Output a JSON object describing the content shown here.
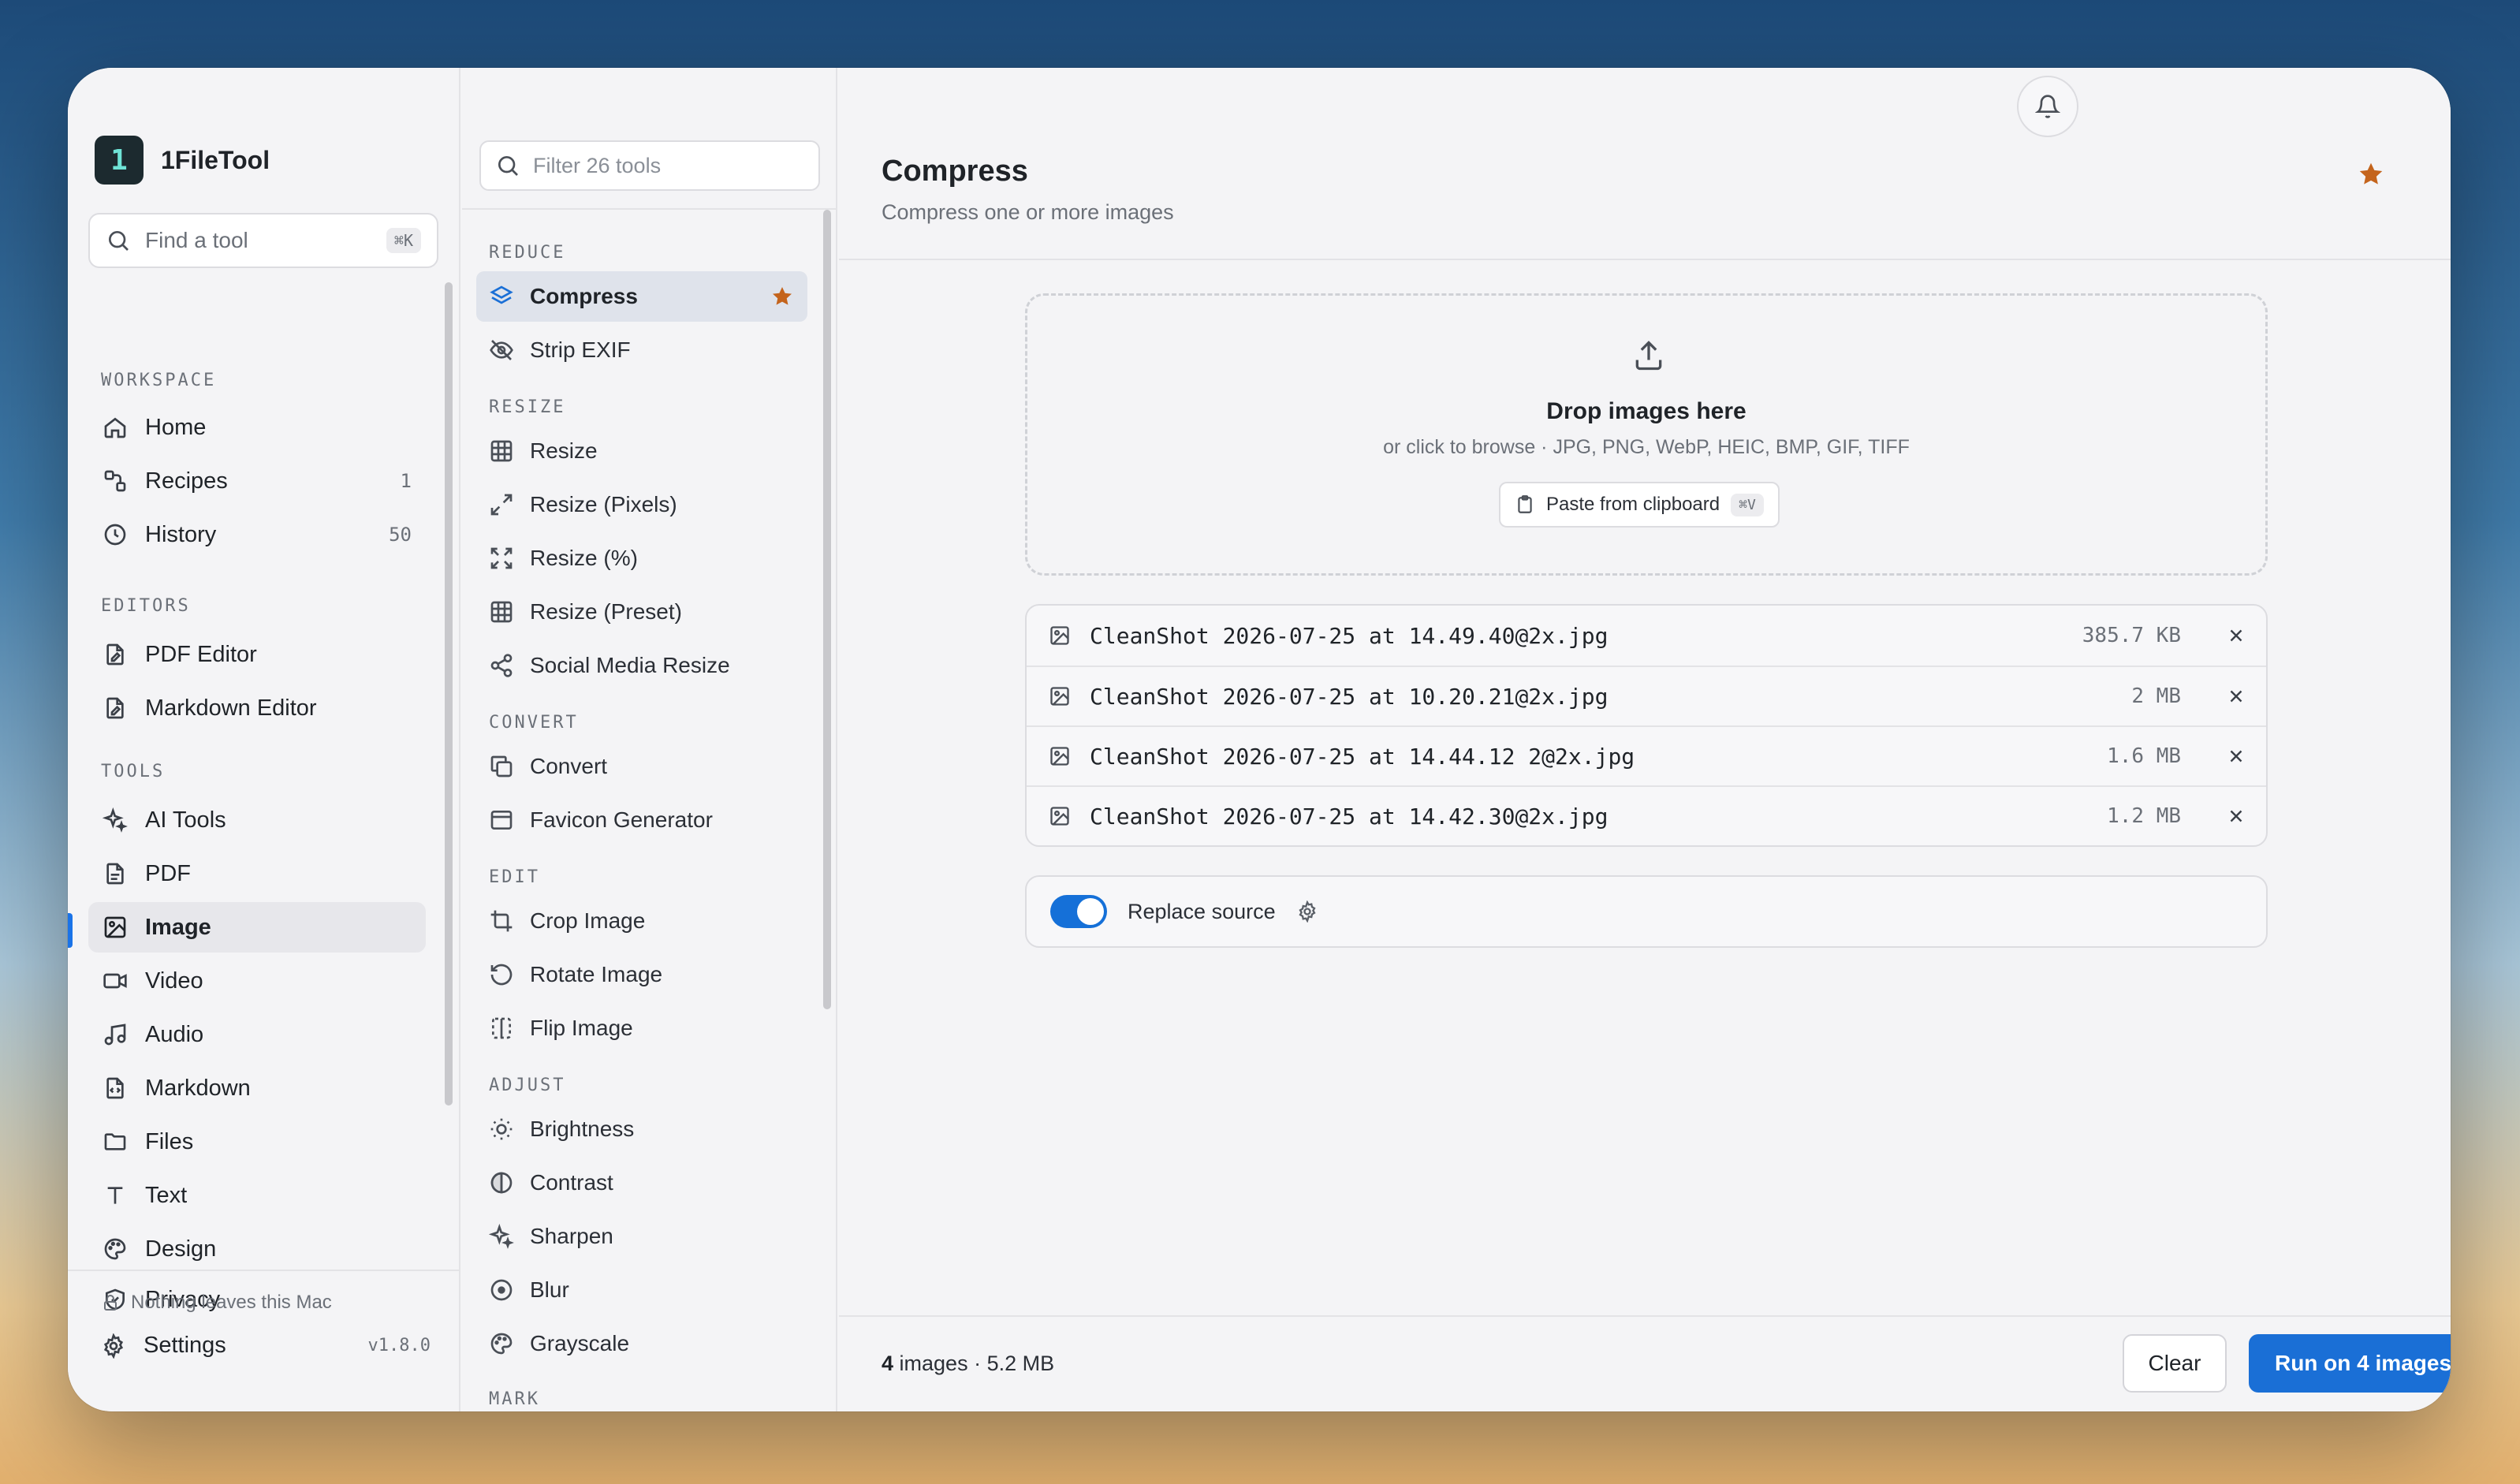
{
  "app": {
    "name": "1FileTool",
    "logo_glyph": "1"
  },
  "sidebar": {
    "search": {
      "placeholder": "Find a tool",
      "shortcut": "⌘K"
    },
    "sections": {
      "workspace": "WORKSPACE",
      "editors": "EDITORS",
      "tools": "TOOLS"
    },
    "workspace_items": [
      {
        "label": "Home",
        "icon": "home-icon",
        "count": ""
      },
      {
        "label": "Recipes",
        "icon": "recipes-icon",
        "count": "1"
      },
      {
        "label": "History",
        "icon": "clock-icon",
        "count": "50"
      }
    ],
    "editor_items": [
      {
        "label": "PDF Editor",
        "icon": "file-edit-icon"
      },
      {
        "label": "Markdown Editor",
        "icon": "file-edit-icon"
      }
    ],
    "tool_items": [
      {
        "label": "AI Tools",
        "icon": "sparkles-icon"
      },
      {
        "label": "PDF",
        "icon": "file-icon"
      },
      {
        "label": "Image",
        "icon": "image-icon",
        "active": true
      },
      {
        "label": "Video",
        "icon": "video-icon"
      },
      {
        "label": "Audio",
        "icon": "music-icon"
      },
      {
        "label": "Markdown",
        "icon": "file-code-icon"
      },
      {
        "label": "Files",
        "icon": "folder-icon"
      },
      {
        "label": "Text",
        "icon": "text-icon"
      },
      {
        "label": "Design",
        "icon": "palette-icon"
      },
      {
        "label": "Privacy",
        "icon": "shield-icon"
      }
    ],
    "privacy_note": "Nothing leaves this Mac",
    "settings_label": "Settings",
    "version": "v1.8.0"
  },
  "tools_panel": {
    "filter_placeholder": "Filter 26 tools",
    "sections": {
      "reduce": "REDUCE",
      "resize": "RESIZE",
      "convert": "CONVERT",
      "edit": "EDIT",
      "adjust": "ADJUST",
      "mark": "MARK"
    },
    "reduce": [
      {
        "label": "Compress",
        "icon": "layers-icon",
        "active": true,
        "starred": true
      },
      {
        "label": "Strip EXIF",
        "icon": "eye-off-icon"
      }
    ],
    "resize": [
      {
        "label": "Resize",
        "icon": "grid-icon"
      },
      {
        "label": "Resize (Pixels)",
        "icon": "expand-icon"
      },
      {
        "label": "Resize (%)",
        "icon": "maximize-icon"
      },
      {
        "label": "Resize (Preset)",
        "icon": "grid-icon"
      },
      {
        "label": "Social Media Resize",
        "icon": "share-icon"
      }
    ],
    "convert": [
      {
        "label": "Convert",
        "icon": "copy-icon"
      },
      {
        "label": "Favicon Generator",
        "icon": "browser-icon"
      }
    ],
    "edit": [
      {
        "label": "Crop Image",
        "icon": "crop-icon"
      },
      {
        "label": "Rotate Image",
        "icon": "rotate-icon"
      },
      {
        "label": "Flip Image",
        "icon": "flip-icon"
      }
    ],
    "adjust": [
      {
        "label": "Brightness",
        "icon": "sun-icon"
      },
      {
        "label": "Contrast",
        "icon": "contrast-icon"
      },
      {
        "label": "Sharpen",
        "icon": "sparkles-icon"
      },
      {
        "label": "Blur",
        "icon": "blur-icon"
      },
      {
        "label": "Grayscale",
        "icon": "palette-icon"
      }
    ]
  },
  "main": {
    "title": "Compress",
    "subtitle": "Compress one or more images",
    "dropzone": {
      "title": "Drop images here",
      "subtitle": "or click to browse · JPG, PNG, WebP, HEIC, BMP, GIF, TIFF",
      "paste_label": "Paste from clipboard",
      "paste_shortcut": "⌘V"
    },
    "files": [
      {
        "name": "CleanShot 2026-07-25 at 14.49.40@2x.jpg",
        "size": "385.7 KB"
      },
      {
        "name": "CleanShot 2026-07-25 at 10.20.21@2x.jpg",
        "size": "2 MB"
      },
      {
        "name": "CleanShot 2026-07-25 at 14.44.12 2@2x.jpg",
        "size": "1.6 MB"
      },
      {
        "name": "CleanShot 2026-07-25 at 14.42.30@2x.jpg",
        "size": "1.2 MB"
      }
    ],
    "options": {
      "replace_source_label": "Replace source",
      "replace_source_on": true
    },
    "footer": {
      "count": "4",
      "count_suffix": " images · 5.2 MB",
      "clear_label": "Clear",
      "run_label": "Run on 4 images"
    }
  },
  "colors": {
    "accent": "#1a6fd6",
    "star": "#c4641c",
    "active_indicator": "#1a73e8"
  }
}
